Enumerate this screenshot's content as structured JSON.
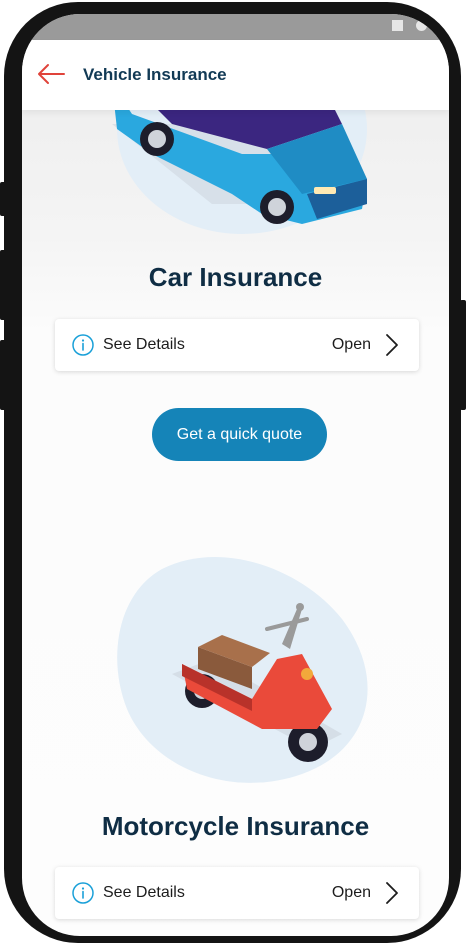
{
  "app_bar": {
    "title": "Vehicle Insurance",
    "back_icon": "arrow-left-icon"
  },
  "colors": {
    "accent": "#1584b8",
    "back_arrow": "#e0433a",
    "title": "#0f2d44",
    "info": "#1aa0d8"
  },
  "sections": [
    {
      "title": "Car Insurance",
      "illustration": "car-illustration",
      "details_label": "See Details",
      "action_label": "Open",
      "cta_label": "Get a quick quote"
    },
    {
      "title": "Motorcycle Insurance",
      "illustration": "motorcycle-illustration",
      "details_label": "See Details",
      "action_label": "Open"
    }
  ]
}
